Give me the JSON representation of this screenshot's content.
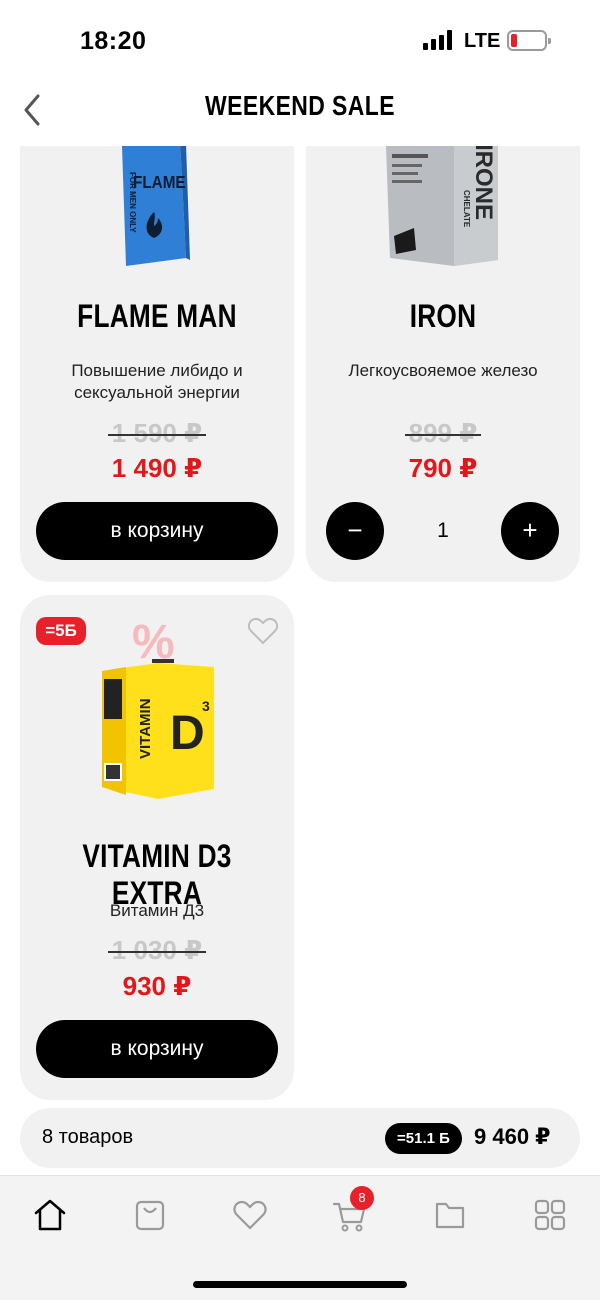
{
  "status_bar": {
    "time": "18:20",
    "network": "LTE",
    "battery_level": 0.15
  },
  "header": {
    "title": "WEEKEND SALE",
    "back_icon": "chevron-left-icon"
  },
  "products": [
    {
      "name": "FLAME MAN",
      "description": "Повышение либидо и сексуальной энергии",
      "old_price": "1 590 ₽",
      "price": "1 490 ₽",
      "action_label": "в корзину",
      "package_text": "FLAME",
      "package_side_text": "FOR MEN ONLY",
      "package_color": "#2f7fd6"
    },
    {
      "name": "IRON",
      "description": "Легкоусвояемое железо",
      "old_price": "899 ₽",
      "price": "790 ₽",
      "quantity": "1",
      "minus_label": "−",
      "plus_label": "+",
      "package_text": "IRONE",
      "package_sub_text": "CHELATE",
      "package_color": "#b9bcc0"
    },
    {
      "name": "VITAMIN D3 EXTRA",
      "description": "Витамин Д3",
      "old_price": "1 030 ₽",
      "price": "930 ₽",
      "action_label": "в корзину",
      "badge": "=5Б",
      "sale_mark": "%",
      "package_text": "VITAMIN",
      "package_big": "D",
      "package_sup": "3",
      "package_color": "#ffe01b"
    }
  ],
  "summary": {
    "count": "8 товаров",
    "bonus": "=51.1 Б",
    "total": "9 460 ₽"
  },
  "tabbar": {
    "items": [
      "home-icon",
      "bag-icon",
      "heart-icon",
      "cart-icon",
      "folder-icon",
      "grid-icon"
    ],
    "cart_count": "8"
  },
  "colors": {
    "accent_red": "#e3161c",
    "card_bg": "#f1f1f1",
    "button_black": "#000000"
  }
}
